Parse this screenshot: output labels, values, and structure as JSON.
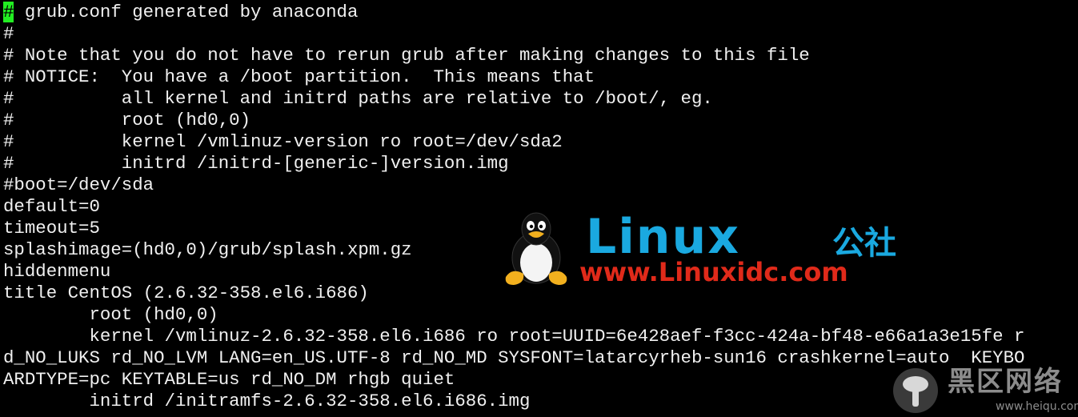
{
  "terminal": {
    "background_color": "#000000",
    "text_color": "#f0f0f0",
    "cursor_color": "#22ee22",
    "cursor_char": "#",
    "first_line_rest": " grub.conf generated by anaconda",
    "lines": [
      "#",
      "# Note that you do not have to rerun grub after making changes to this file",
      "# NOTICE:  You have a /boot partition.  This means that",
      "#          all kernel and initrd paths are relative to /boot/, eg.",
      "#          root (hd0,0)",
      "#          kernel /vmlinuz-version ro root=/dev/sda2",
      "#          initrd /initrd-[generic-]version.img",
      "#boot=/dev/sda",
      "default=0",
      "timeout=5",
      "splashimage=(hd0,0)/grub/splash.xpm.gz",
      "hiddenmenu",
      "title CentOS (2.6.32-358.el6.i686)",
      "        root (hd0,0)",
      "        kernel /vmlinuz-2.6.32-358.el6.i686 ro root=UUID=6e428aef-f3cc-424a-bf48-e66a1a3e15fe r",
      "d_NO_LUKS rd_NO_LVM LANG=en_US.UTF-8 rd_NO_MD SYSFONT=latarcyrheb-sun16 crashkernel=auto  KEYBO",
      "ARDTYPE=pc KEYTABLE=us rd_NO_DM rhgb quiet",
      "        initrd /initramfs-2.6.32-358.el6.i686.img"
    ]
  },
  "watermarks": {
    "linux": {
      "brand": "Linux",
      "brand_cn": "公社",
      "url": "www.Linuxidc.com",
      "brand_color": "#1aa9e0",
      "url_color": "#e02a1a",
      "icon": "tux-penguin-icon"
    },
    "heiqu": {
      "brand_cn": "黑区网络",
      "url": "www.heiqu.com",
      "color": "#8c8c8c",
      "icon": "heiqu-logo-icon"
    }
  }
}
